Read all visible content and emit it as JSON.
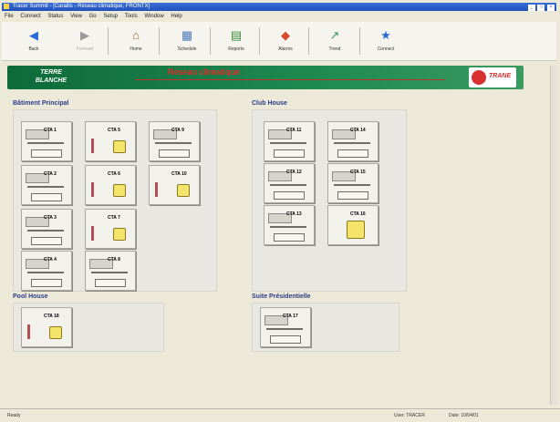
{
  "titlebar": {
    "title": "Tracer Summit - [Carallis - Réseau climatique, FRONTX]"
  },
  "window_controls": [
    "_",
    "□",
    "×"
  ],
  "menu": [
    "File",
    "Connect",
    "Status",
    "View",
    "Go",
    "Setup",
    "Tools",
    "Window",
    "Help"
  ],
  "toolbar": {
    "buttons": [
      {
        "label": "Back",
        "icon": "◀"
      },
      {
        "label": "Forward",
        "icon": "▶"
      },
      {
        "label": "Home",
        "icon": "⌂"
      },
      {
        "label": "Schedule",
        "icon": "▦"
      },
      {
        "label": "Reports",
        "icon": "▤"
      },
      {
        "label": "Alarms",
        "icon": "◆"
      },
      {
        "label": "Trend",
        "icon": "↗"
      },
      {
        "label": "Connect",
        "icon": "★"
      }
    ]
  },
  "banner": {
    "left_text_line1": "TERRE",
    "left_text_line2": "BLANCHE",
    "title": "Réseau climatique",
    "brand": "TRANE"
  },
  "colors": {
    "banner_green": "#1f8a50",
    "title_red": "#e02a2a",
    "group_title": "#2a3a8a"
  },
  "groups": {
    "main": {
      "title": "Bâtiment Principal",
      "units": [
        {
          "label": "CTA 1"
        },
        {
          "label": "CTA 5"
        },
        {
          "label": "CTA 9"
        },
        {
          "label": "CTA 2"
        },
        {
          "label": "CTA 6"
        },
        {
          "label": "CTA 10"
        },
        {
          "label": "CTA 3"
        },
        {
          "label": "CTA 7"
        },
        {
          "label": "CTA 4"
        },
        {
          "label": "CTA 8"
        }
      ]
    },
    "club": {
      "title": "Club House",
      "units": [
        {
          "label": "CTA 11"
        },
        {
          "label": "CTA 14"
        },
        {
          "label": "CTA 12"
        },
        {
          "label": "CTA 15"
        },
        {
          "label": "CTA 13"
        },
        {
          "label": "CTA 16"
        }
      ]
    },
    "pool": {
      "title": "Pool House",
      "units": [
        {
          "label": "CTA 18"
        }
      ]
    },
    "suite": {
      "title": "Suite Présidentielle",
      "units": [
        {
          "label": "CTA 17"
        }
      ]
    }
  },
  "status": {
    "left": "Ready",
    "user": "User: TRACER",
    "date": "Date: 10/04/01"
  }
}
